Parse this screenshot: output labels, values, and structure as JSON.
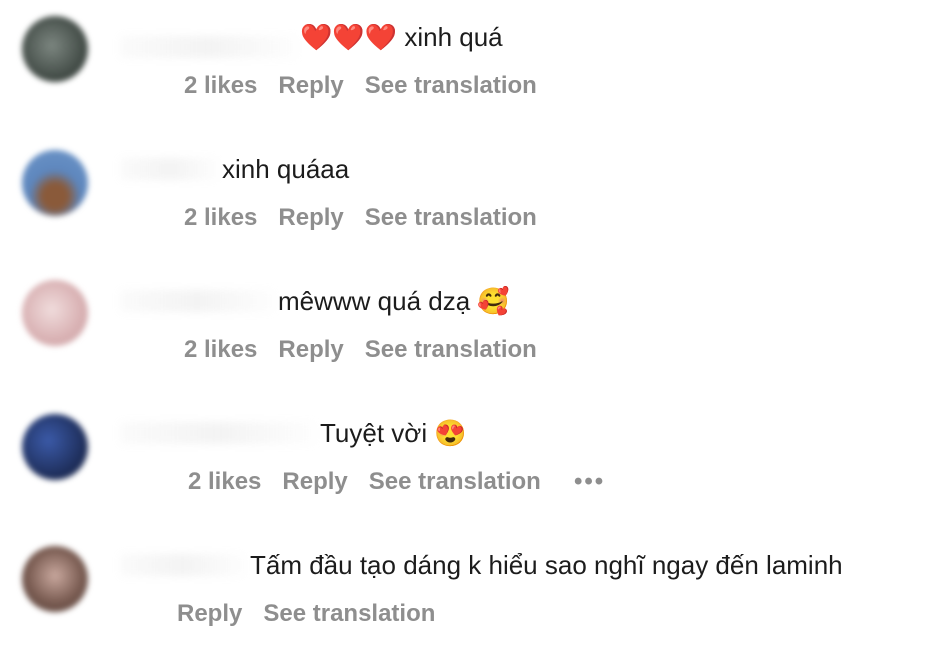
{
  "comments": [
    {
      "text": "❤️❤️❤️ xinh quá",
      "likes": "2 likes",
      "reply": "Reply",
      "translate": "See translation",
      "avatar_color": "#4a5550"
    },
    {
      "text": "xinh quáaa",
      "likes": "2 likes",
      "reply": "Reply",
      "translate": "See translation",
      "avatar_color": "#5a7fb0"
    },
    {
      "text": "mêwww quá dzạ 🥰",
      "likes": "2 likes",
      "reply": "Reply",
      "translate": "See translation",
      "avatar_color": "#d8b8b8"
    },
    {
      "text": "Tuyệt vời 😍",
      "likes": "2 likes",
      "reply": "Reply",
      "translate": "See translation",
      "more": "•••",
      "avatar_color": "#1e2e5a"
    },
    {
      "text": "Tấm đầu tạo dáng k hiểu sao nghĩ ngay đến laminh",
      "reply": "Reply",
      "translate": "See translation",
      "avatar_color": "#6b5048"
    }
  ]
}
